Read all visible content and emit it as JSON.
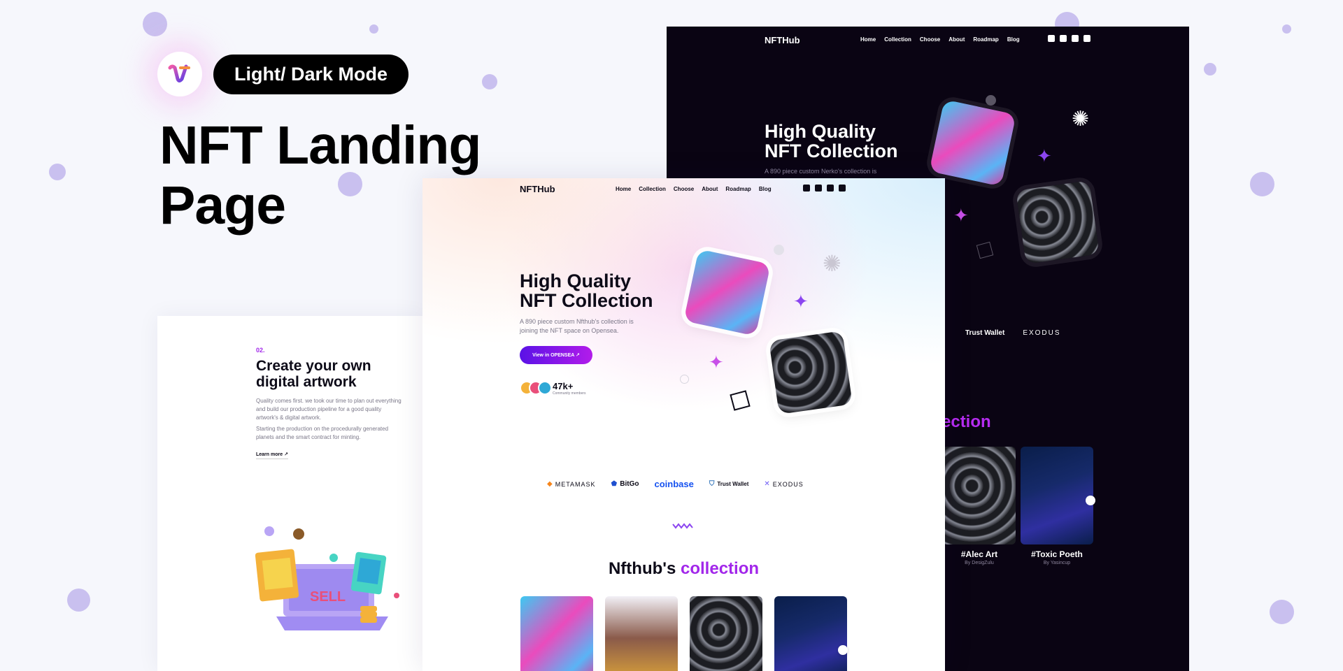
{
  "header": {
    "mode_pill": "Light/ Dark Mode",
    "title_line1": "NFT Landing",
    "title_line2": "Page",
    "logo_icon": "brand-logo-icon"
  },
  "colors": {
    "accent": "#a227ea",
    "dark_bg": "#0a0413",
    "page_bg": "#f6f7fc"
  },
  "nav": {
    "logo": "NFTHub",
    "light_logo": "NFTHub",
    "items": [
      "Home",
      "Collection",
      "Choose",
      "About",
      "Roadmap",
      "Blog"
    ],
    "social_icons": [
      "twitter-icon",
      "discord-icon",
      "instagram-icon",
      "wallet-icon"
    ]
  },
  "hero": {
    "title_line1": "High Quality",
    "title_line2": "NFT Collection",
    "subtitle_light": "A 890 piece custom Nfthub's collection is joining the NFT space on Opensea.",
    "subtitle_dark": "A 890 piece custom Nerko's collection is",
    "cta": "View in OPENSEA ↗",
    "stat_value": "47k+",
    "stat_label": "Community members"
  },
  "partners": {
    "light": [
      "METAMASK",
      "BitGo",
      "coinbase",
      "Trust Wallet",
      "EXODUS"
    ],
    "dark": [
      "Trust Wallet",
      "EXODUS"
    ]
  },
  "collection": {
    "title_prefix": "Nfthub's ",
    "title_highlight": "collection",
    "dark_title_partial": "ollection",
    "dark_items": [
      {
        "name": "#Alec Art",
        "by": "By DesigZulu"
      },
      {
        "name": "#Toxic Poeth",
        "by": "By Yasincup"
      }
    ]
  },
  "feature": {
    "number": "02.",
    "title": "Create your own digital artwork",
    "para1": "Quality comes first. we took our time to plan out everything and build our production pipeline for a good quality artwork's & digital artwork.",
    "para2": "Starting the production on the procedurally generated planets and the smart contract for minting.",
    "link": "Learn more ↗"
  }
}
